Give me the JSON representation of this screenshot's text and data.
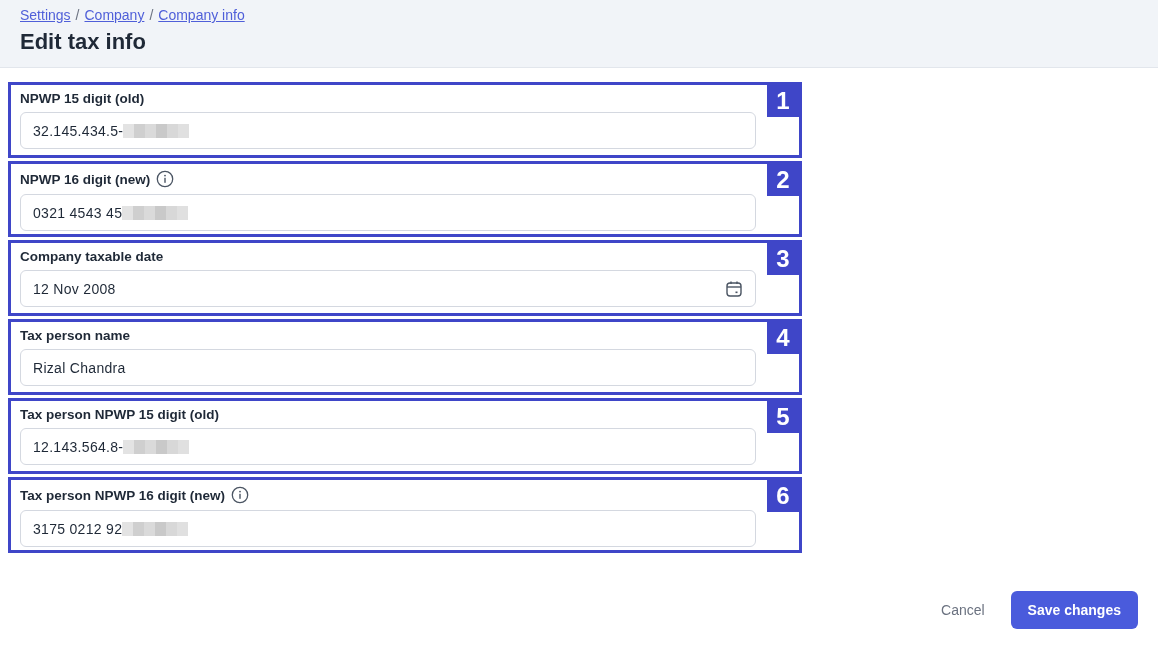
{
  "breadcrumb": [
    "Settings",
    "Company",
    "Company info"
  ],
  "breadcrumb_separator": "/",
  "title": "Edit tax info",
  "fields": [
    {
      "marker": "1",
      "label": "NPWP 15 digit (old)",
      "info": false,
      "kind": "text",
      "value": "32.145.434.5-",
      "redacted": true
    },
    {
      "marker": "2",
      "label": "NPWP 16 digit (new)",
      "info": true,
      "kind": "text",
      "value": "0321 4543 45",
      "redacted": true
    },
    {
      "marker": "3",
      "label": "Company taxable date",
      "info": false,
      "kind": "date",
      "value": "12 Nov 2008",
      "redacted": false
    },
    {
      "marker": "4",
      "label": "Tax person name",
      "info": false,
      "kind": "text",
      "value": "Rizal Chandra",
      "redacted": false
    },
    {
      "marker": "5",
      "label": "Tax person NPWP 15 digit (old)",
      "info": false,
      "kind": "text",
      "value": "12.143.564.8-",
      "redacted": true
    },
    {
      "marker": "6",
      "label": "Tax person NPWP 16 digit (new)",
      "info": true,
      "kind": "text",
      "value": "3175 0212 92",
      "redacted": true
    }
  ],
  "actions": {
    "cancel": "Cancel",
    "save": "Save changes"
  }
}
